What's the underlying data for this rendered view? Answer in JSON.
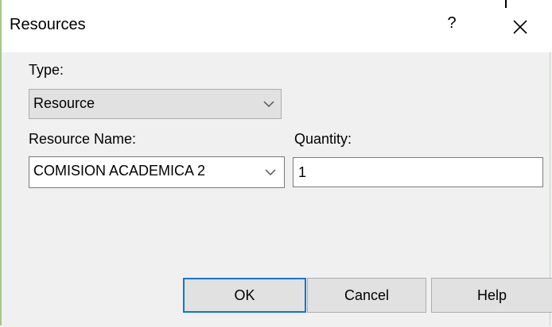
{
  "window": {
    "title": "Resources",
    "help_glyph": "?",
    "close_icon": "close-icon",
    "border_color": "#a8c58a"
  },
  "form": {
    "type_label": "Type:",
    "type_value": "Resource",
    "resource_name_label": "Resource Name:",
    "resource_name_value": "COMISION ACADEMICA 2",
    "quantity_label": "Quantity:",
    "quantity_value": "1"
  },
  "buttons": {
    "ok": "OK",
    "cancel": "Cancel",
    "help": "Help",
    "default_accent": "#0078d7"
  }
}
